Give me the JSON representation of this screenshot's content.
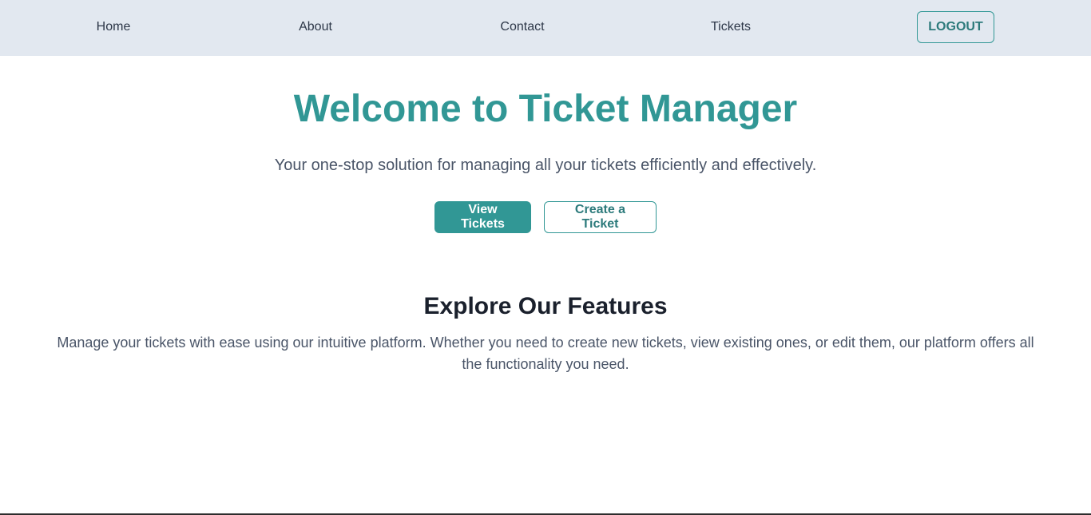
{
  "nav": {
    "items": [
      {
        "label": "Home"
      },
      {
        "label": "About"
      },
      {
        "label": "Contact"
      },
      {
        "label": "Tickets"
      }
    ],
    "logout_label": "LOGOUT"
  },
  "hero": {
    "title": "Welcome to Ticket Manager",
    "subtitle": "Your one-stop solution for managing all your tickets efficiently and effectively.",
    "primary_button": "View Tickets",
    "secondary_button": "Create a Ticket"
  },
  "features": {
    "title": "Explore Our Features",
    "text": "Manage your tickets with ease using our intuitive platform. Whether you need to create new tickets, view existing ones, or edit them, our platform offers all the functionality you need."
  },
  "colors": {
    "accent": "#319795",
    "nav_background": "#e2e8f0",
    "heading": "#1a202c",
    "body_text": "#4a5568"
  }
}
